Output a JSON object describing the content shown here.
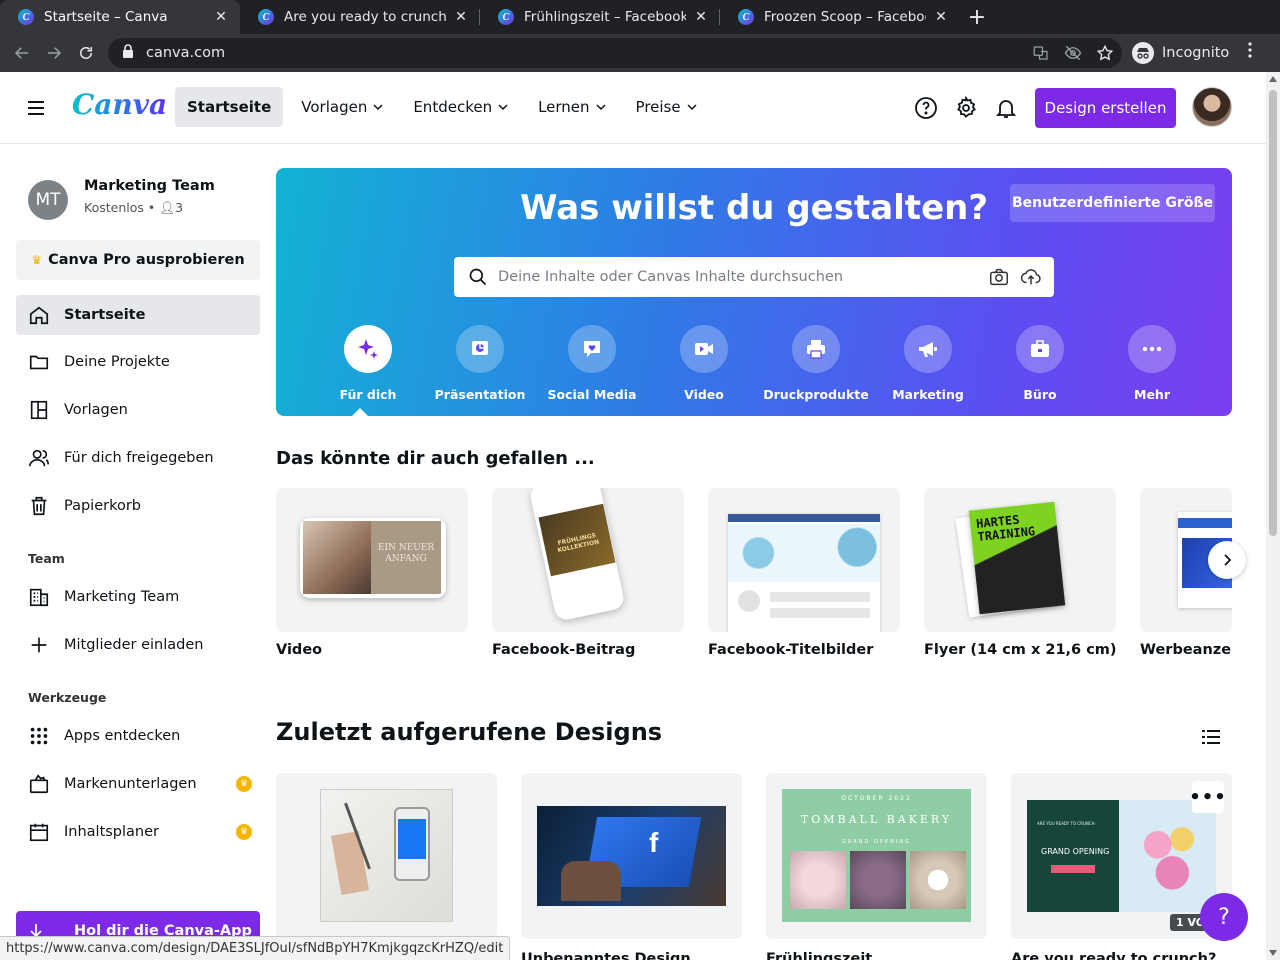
{
  "browser": {
    "tabs": [
      {
        "title": "Startseite – Canva"
      },
      {
        "title": "Are you ready to crunch? – Facebook-Beitrag"
      },
      {
        "title": "Frühlingszeit – Facebook-Beitrag"
      },
      {
        "title": "Froozen Scoop – Facebook-Beitrag"
      }
    ],
    "url": "canva.com",
    "incognito_label": "Incognito"
  },
  "header": {
    "logo": "Canva",
    "nav": [
      {
        "label": "Startseite"
      },
      {
        "label": "Vorlagen"
      },
      {
        "label": "Entdecken"
      },
      {
        "label": "Lernen"
      },
      {
        "label": "Preise"
      }
    ],
    "create_button": "Design erstellen"
  },
  "sidebar": {
    "team_initials": "MT",
    "team_name": "Marketing Team",
    "team_plan": "Kostenlos",
    "team_members": "3",
    "pro_button": "Canva Pro ausprobieren",
    "items": [
      {
        "label": "Startseite"
      },
      {
        "label": "Deine Projekte"
      },
      {
        "label": "Vorlagen"
      },
      {
        "label": "Für dich freigegeben"
      },
      {
        "label": "Papierkorb"
      }
    ],
    "team_heading": "Team",
    "team_items": [
      {
        "label": "Marketing Team"
      },
      {
        "label": "Mitglieder einladen"
      }
    ],
    "tools_heading": "Werkzeuge",
    "tools_items": [
      {
        "label": "Apps entdecken"
      },
      {
        "label": "Markenunterlagen"
      },
      {
        "label": "Inhaltsplaner"
      }
    ],
    "app_button": "Hol dir die Canva-App"
  },
  "hero": {
    "title": "Was willst du gestalten?",
    "custom_size": "Benutzerdefinierte Größe",
    "search_placeholder": "Deine Inhalte oder Canvas Inhalte durchsuchen",
    "categories": [
      {
        "label": "Für dich"
      },
      {
        "label": "Präsentation"
      },
      {
        "label": "Social Media"
      },
      {
        "label": "Video"
      },
      {
        "label": "Druckprodukte"
      },
      {
        "label": "Marketing"
      },
      {
        "label": "Büro"
      },
      {
        "label": "Mehr"
      }
    ]
  },
  "suggestions": {
    "title": "Das könnte dir auch gefallen ...",
    "items": [
      {
        "label": "Video",
        "thumb_text": "EIN NEUER ANFANG"
      },
      {
        "label": "Facebook-Beitrag",
        "thumb_text": "FRÜHLINGS KOLLEKTION"
      },
      {
        "label": "Facebook-Titelbilder",
        "thumb_text": ""
      },
      {
        "label": "Flyer (14 cm x 21,6 cm)",
        "thumb_text": "HARTES TRAINING"
      },
      {
        "label": "Werbeanzeige"
      }
    ]
  },
  "recent": {
    "title": "Zuletzt aufgerufene Designs",
    "items": [
      {
        "label": ""
      },
      {
        "label": "Unbenanntes Design"
      },
      {
        "label": "Frühlingszeit",
        "thumb_top": "OCTOBER 2022",
        "thumb_title": "TOMBALL BAKERY",
        "thumb_sub": "GRAND OPENING"
      },
      {
        "label": "Are you ready to crunch?",
        "thumb_title": "GRAND OPENING",
        "thumb_top": "ARE YOU READY TO CRUNCH"
      }
    ],
    "badge": "1 VO"
  },
  "help_label": "?",
  "status_url": "https://www.canva.com/design/DAE3SLJfOuI/sfNdBpYH7KmjkgqzcKrHZQ/edit",
  "colors": {
    "brand_purple": "#7d2ae8",
    "hero_start": "#13b3d4",
    "hero_end": "#7a3ef0",
    "premium_gold": "#f7b500"
  }
}
